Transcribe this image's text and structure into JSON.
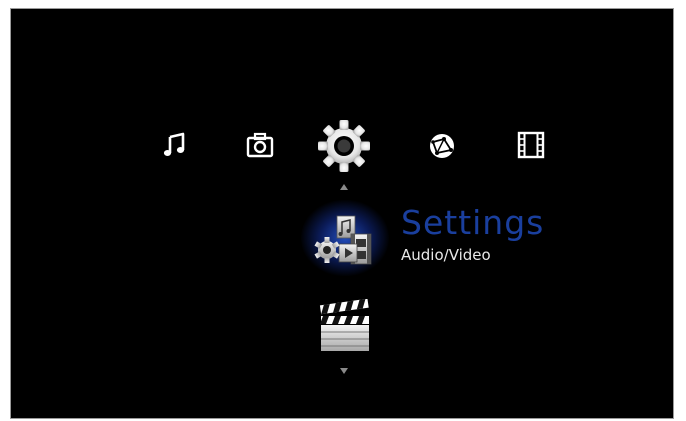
{
  "menu": {
    "icons": [
      {
        "id": "music",
        "icon": "music-note-icon"
      },
      {
        "id": "photo",
        "icon": "camera-icon"
      },
      {
        "id": "settings",
        "icon": "gear-icon",
        "selected": true
      },
      {
        "id": "network",
        "icon": "network-globe-icon"
      },
      {
        "id": "video",
        "icon": "film-strip-icon"
      }
    ]
  },
  "selected": {
    "title": "Settings",
    "subtitle": "Audio/Video",
    "icon": "audio-video-settings-icon"
  },
  "next": {
    "icon": "clapperboard-icon"
  },
  "colors": {
    "background": "#000000",
    "title": "#1a3f9e",
    "subtitle": "#e8e8e8",
    "highlight_glow": "#2855dc",
    "arrow": "#8a8a8a"
  }
}
